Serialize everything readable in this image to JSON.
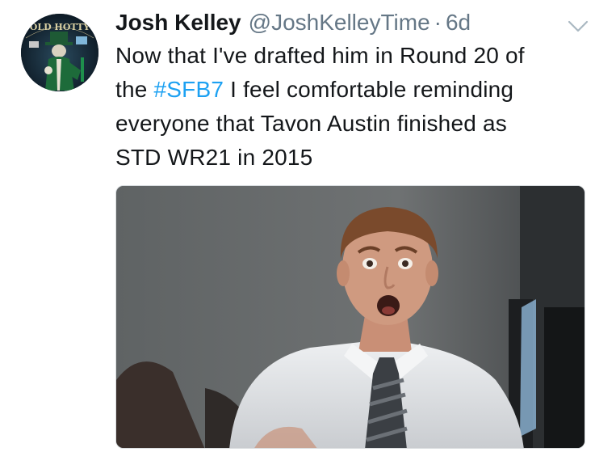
{
  "tweet": {
    "author_name": "Josh Kelley",
    "author_handle": "@JoshKelleyTime",
    "separator": "·",
    "timestamp": "6d",
    "text_line1": "Now that I've drafted him in Round 20 of",
    "text_line2_before": "the ",
    "hashtag": "#SFB7",
    "text_line2_after": " I feel comfortable reminding",
    "text_line3": "everyone that Tavon Austin finished as",
    "text_line4": "STD WR21 in 2015",
    "avatar_text": "OLD HOTTY"
  },
  "icons": {
    "caret": "chevron-down-icon"
  },
  "colors": {
    "text": "#14171a",
    "secondary": "#657786",
    "hashtag": "#1da1f2"
  }
}
